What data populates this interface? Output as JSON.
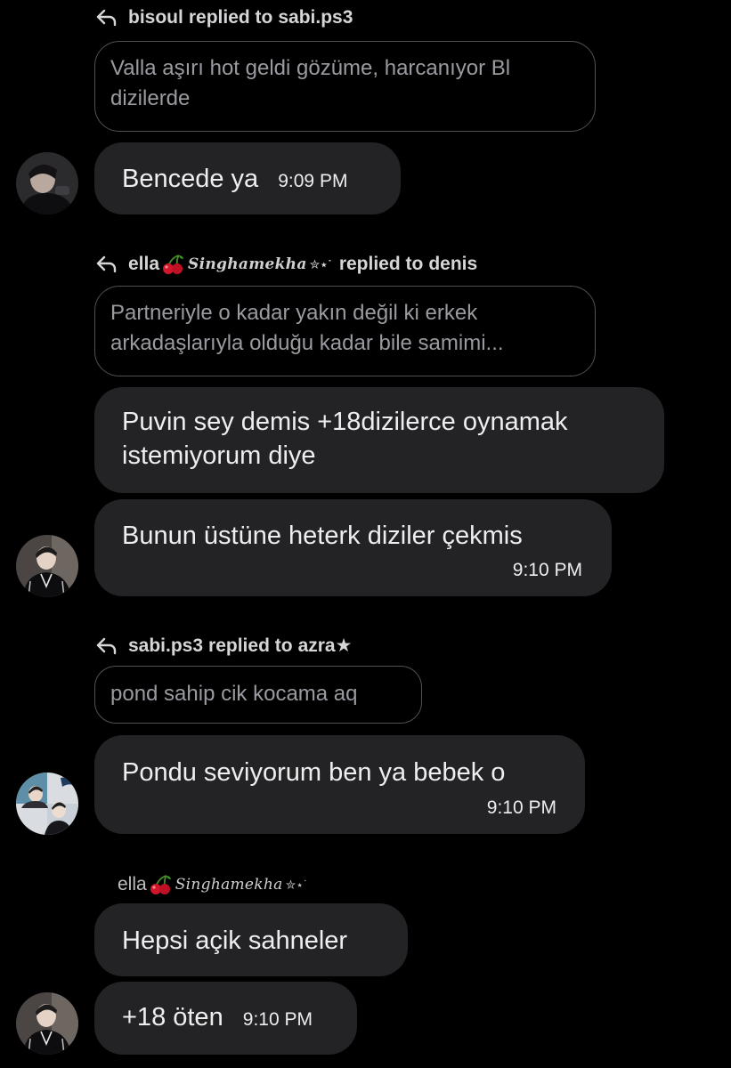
{
  "thread": [
    {
      "reply_header": {
        "author": "bisoul",
        "connector": "replied to",
        "target": "sabi.ps3"
      },
      "quote": "Valla aşırı hot geldi gözüme, harcanıyor Bl dizilerde",
      "messages": [
        {
          "text": "Bencede ya",
          "time": "9:09 PM"
        }
      ],
      "avatar_icon": "person-avatar-dark-photo"
    },
    {
      "reply_header": {
        "author": "ella",
        "author_emoji": "cherry-emoji",
        "author_script": "Singhamekha",
        "author_symbols": "✮⋆˙",
        "connector": "replied to",
        "target": "denis"
      },
      "quote": "Partneriyle o kadar yakın değil ki erkek arkadaşlarıyla olduğu kadar bile samimi...",
      "messages": [
        {
          "text": "Puvin sey demis +18dizilerce oynamak istemiyorum diye"
        },
        {
          "text": "Bunun üstüne heterk diziler çekmis",
          "time": "9:10 PM"
        }
      ],
      "avatar_icon": "person-avatar-black-jacket"
    },
    {
      "reply_header": {
        "author": "sabi.ps3",
        "connector": "replied to",
        "target": "azra★"
      },
      "quote": "pond sahip cik kocama aq",
      "messages": [
        {
          "text": "Pondu seviyorum ben ya bebek o",
          "time": "9:10 PM"
        }
      ],
      "avatar_icon": "person-avatar-collage"
    },
    {
      "sender_label": {
        "author": "ella",
        "author_emoji": "cherry-emoji",
        "author_script": "Singhamekha",
        "author_symbols": "✮⋆˙"
      },
      "messages": [
        {
          "text": "Hepsi açik sahneler"
        },
        {
          "text": "+18 öten",
          "time": "9:10 PM"
        }
      ],
      "avatar_icon": "person-avatar-black-jacket"
    }
  ],
  "colors": {
    "background": "#000000",
    "bubble": "#232326",
    "quote_border": "#505156",
    "quote_text": "#9a9aa0",
    "text": "#eeeeef"
  }
}
